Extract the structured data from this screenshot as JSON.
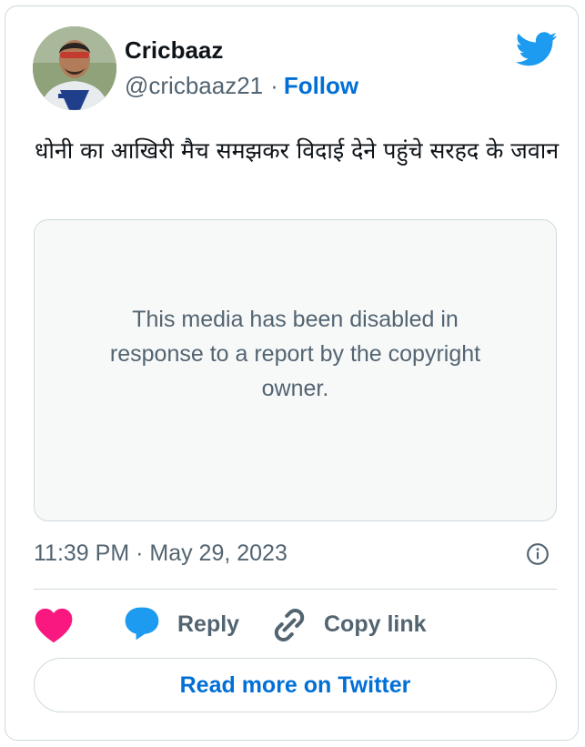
{
  "author": {
    "name": "Cricbaaz",
    "handle": "@cricbaaz21",
    "separator": "·",
    "follow_label": "Follow"
  },
  "tweet": {
    "text": "धोनी का आखिरी मैच समझकर विदाई देने पहुंचे सरहद के जवान",
    "media_notice": "This media has been disabled in response to a report by the copyright owner.",
    "timestamp": "11:39 PM · May 29, 2023"
  },
  "actions": {
    "reply_label": "Reply",
    "copy_link_label": "Copy link"
  },
  "footer": {
    "read_more_label": "Read more on Twitter"
  },
  "icons": {
    "brand": "twitter-bird-icon",
    "info": "info-icon",
    "like": "heart-icon",
    "reply": "reply-bubble-icon",
    "link": "link-icon"
  },
  "colors": {
    "twitter_blue": "#1d9bf0",
    "link_blue": "#006fd6",
    "like_pink": "#f91880",
    "muted_text": "#536471",
    "border": "#cfd9de"
  }
}
